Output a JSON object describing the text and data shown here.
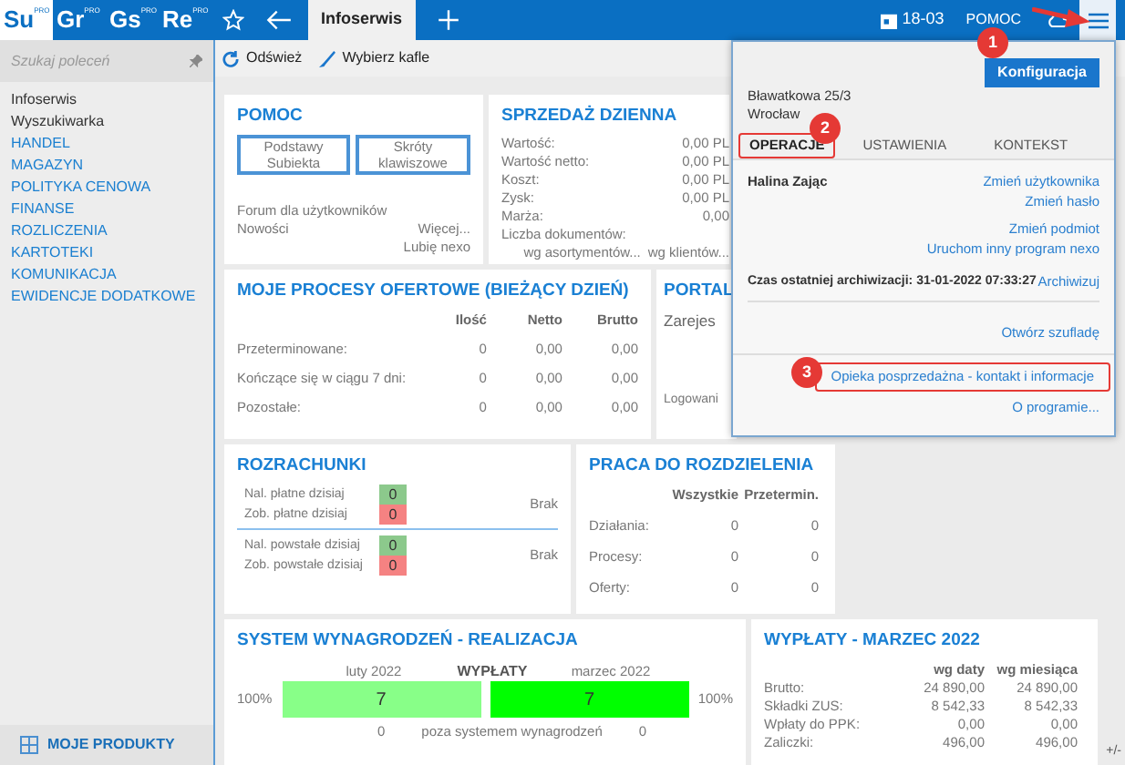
{
  "top_bar": {
    "apps": [
      {
        "label": "Su",
        "badge": "PRO",
        "selected": true
      },
      {
        "label": "Gr",
        "badge": "PRO",
        "selected": false
      },
      {
        "label": "Gs",
        "badge": "PRO",
        "selected": false
      },
      {
        "label": "Re",
        "badge": "PRO",
        "selected": false
      }
    ],
    "tab": "Infoserwis",
    "date": "18-03",
    "help": "POMOC"
  },
  "sidebar": {
    "search_placeholder": "Szukaj poleceń",
    "items": [
      {
        "label": "Infoserwis",
        "kind": "page"
      },
      {
        "label": "Wyszukiwarka",
        "kind": "page"
      },
      {
        "label": "HANDEL",
        "kind": "module"
      },
      {
        "label": "MAGAZYN",
        "kind": "module"
      },
      {
        "label": "POLITYKA CENOWA",
        "kind": "module"
      },
      {
        "label": "FINANSE",
        "kind": "module"
      },
      {
        "label": "ROZLICZENIA",
        "kind": "module"
      },
      {
        "label": "KARTOTEKI",
        "kind": "module"
      },
      {
        "label": "KOMUNIKACJA",
        "kind": "module"
      },
      {
        "label": "EWIDENCJE DODATKOWE",
        "kind": "module"
      }
    ],
    "footer": "MOJE PRODUKTY"
  },
  "toolbar": [
    {
      "label": "Odśwież",
      "kind": "refresh"
    },
    {
      "label": "Wybierz kafle",
      "kind": "brush"
    }
  ],
  "pomoc": {
    "title": "POMOC",
    "buttons": [
      "Podstawy Subiekta",
      "Skróty klawiszowe"
    ],
    "links": [
      "Forum dla użytkowników",
      "Nowości"
    ],
    "right_links": [
      "Więcej...",
      "Lubię nexo"
    ]
  },
  "sprzedaz": {
    "title": "SPRZEDAŻ DZIENNA",
    "rows": [
      {
        "label": "Wartość:",
        "value": "0,00 PL"
      },
      {
        "label": "Wartość netto:",
        "value": "0,00 PL"
      },
      {
        "label": "Koszt:",
        "value": "0,00 PL"
      },
      {
        "label": "Zysk:",
        "value": "0,00 PL"
      },
      {
        "label": "Marża:",
        "value": "0,00"
      },
      {
        "label": "Liczba dokumentów:",
        "value": ""
      }
    ],
    "links": [
      "wg asortymentów...",
      "wg klientów..."
    ]
  },
  "procesy": {
    "title": "MOJE PROCESY OFERTOWE (BIEŻĄCY DZIEŃ)",
    "columns": [
      "Ilość",
      "Netto",
      "Brutto"
    ],
    "rows": [
      {
        "label": "Przeterminowane:",
        "values": [
          "0",
          "0,00",
          "0,00"
        ]
      },
      {
        "label": "Kończące się w ciągu 7 dni:",
        "values": [
          "0",
          "0,00",
          "0,00"
        ]
      },
      {
        "label": "Pozostałe:",
        "values": [
          "0",
          "0,00",
          "0,00"
        ]
      }
    ]
  },
  "portal": {
    "title": "PORTAL",
    "lines": [
      "Zarejes",
      "Logowani"
    ]
  },
  "rozrachunki": {
    "title": "ROZRACHUNKI",
    "groups": [
      {
        "note": "Brak",
        "rows": [
          {
            "label": "Nal. płatne dzisiaj",
            "value": "0",
            "color": "#8cc98c"
          },
          {
            "label": "Zob. płatne dzisiaj",
            "value": "0",
            "color": "#f58282"
          }
        ]
      },
      {
        "note": "Brak",
        "rows": [
          {
            "label": "Nal. powstałe dzisiaj",
            "value": "0",
            "color": "#8cc98c"
          },
          {
            "label": "Zob. powstałe dzisiaj",
            "value": "0",
            "color": "#f58282"
          }
        ]
      }
    ]
  },
  "praca": {
    "title": "PRACA DO ROZDZIELENIA",
    "columns": [
      "Wszystkie",
      "Przetermin."
    ],
    "rows": [
      {
        "label": "Działania:",
        "values": [
          "0",
          "0"
        ]
      },
      {
        "label": "Procesy:",
        "values": [
          "0",
          "0"
        ]
      },
      {
        "label": "Oferty:",
        "values": [
          "0",
          "0"
        ]
      }
    ]
  },
  "system": {
    "title": "SYSTEM WYNAGRODZEŃ - REALIZACJA",
    "heading": "WYPŁATY",
    "months": [
      "luty 2022",
      "marzec 2022"
    ],
    "bars": [
      {
        "percent": "100%",
        "value": "7",
        "color": "#88ff88"
      },
      {
        "percent": "100%",
        "value": "7",
        "color": "#00ff00"
      }
    ],
    "footer": [
      "0",
      "poza systemem wynagrodzeń",
      "0"
    ]
  },
  "wyplaty": {
    "title": "WYPŁATY - MARZEC 2022",
    "columns": [
      "wg daty",
      "wg miesiąca"
    ],
    "rows": [
      {
        "label": "Brutto:",
        "values": [
          "24 890,00",
          "24 890,00"
        ]
      },
      {
        "label": "Składki ZUS:",
        "values": [
          "8 542,33",
          "8 542,33"
        ]
      },
      {
        "label": "Wpłaty do PPK:",
        "values": [
          "0,00",
          "0,00"
        ]
      },
      {
        "label": "Zaliczki:",
        "values": [
          "496,00",
          "496,00"
        ]
      }
    ]
  },
  "panel": {
    "address": [
      "Bławatkowa 25/3",
      "Wrocław"
    ],
    "button": "Konfiguracja",
    "tabs": [
      {
        "label": "OPERACJE",
        "selected": true
      },
      {
        "label": "USTAWIENIA",
        "selected": false
      },
      {
        "label": "KONTEKST",
        "selected": false
      }
    ],
    "user": "Halina Zając",
    "user_links": [
      "Zmień użytkownika",
      "Zmień hasło"
    ],
    "links": [
      "Zmień podmiot",
      "Uruchom inny program nexo"
    ],
    "archive": "Czas ostatniej archiwizacji: 31-01-2022 07:33:27",
    "archive_link": "Archiwizuj",
    "drawer": "Otwórz szufladę",
    "bottom_links": [
      {
        "label": "Opieka posprzedażna - kontakt i informacje",
        "highlighted": true
      },
      {
        "label": "O programie...",
        "highlighted": false
      }
    ]
  },
  "annotations": [
    "1",
    "2",
    "3"
  ],
  "status": "+/-"
}
